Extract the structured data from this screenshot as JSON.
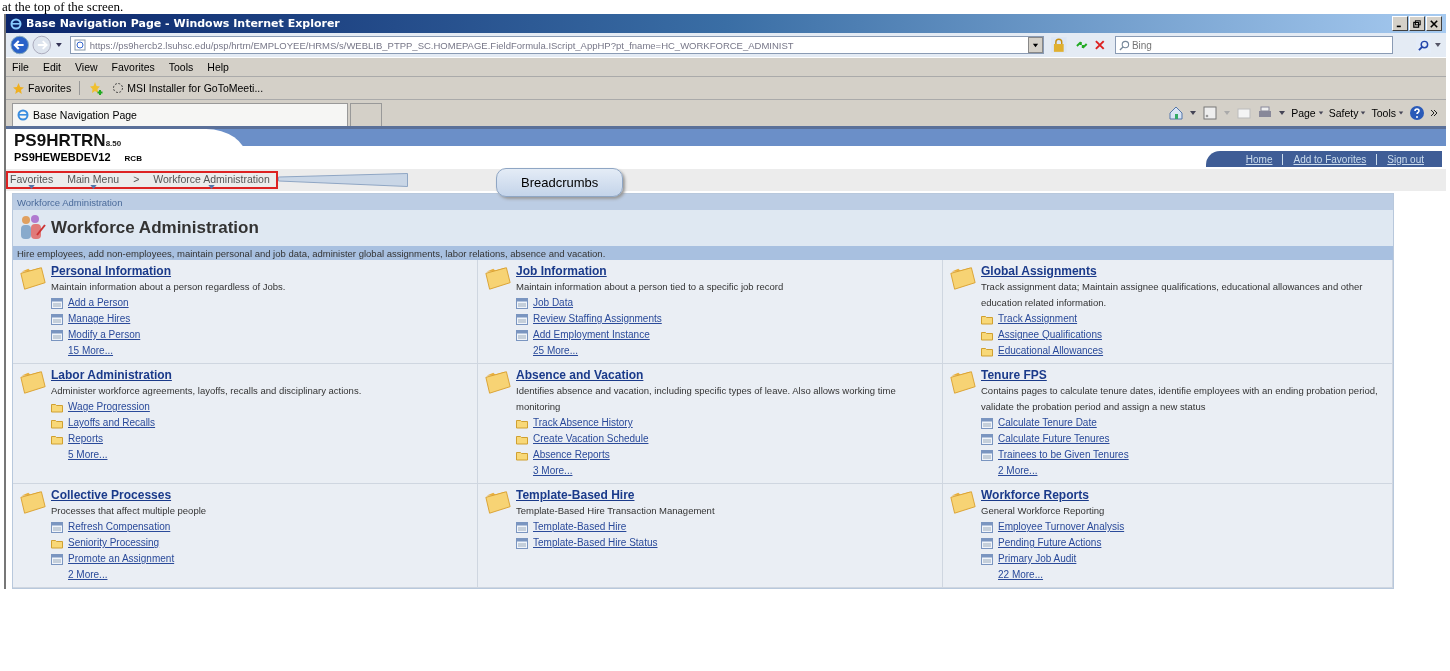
{
  "caption": "at the top of the screen.",
  "window": {
    "title": "Base Navigation Page - Windows Internet Explorer"
  },
  "address": {
    "value": "https://ps9hercb2.lsuhsc.edu/psp/hrtrn/EMPLOYEE/HRMS/s/WEBLIB_PTPP_SC.HOMEPAGE.FieldFormula.IScript_AppHP?pt_fname=HC_WORKFORCE_ADMINIST",
    "search_placeholder": "Bing"
  },
  "menu": [
    "File",
    "Edit",
    "View",
    "Favorites",
    "Tools",
    "Help"
  ],
  "favorites_bar": {
    "label": "Favorites",
    "items": [
      "MSI Installer for GoToMeeti..."
    ]
  },
  "tab": {
    "label": "Base Navigation Page"
  },
  "command_bar": [
    "Page",
    "Safety",
    "Tools"
  ],
  "app": {
    "name": "PS9HRTRN",
    "version": "8.50",
    "server": "PS9HEWEBDEV12",
    "user": "RCB",
    "links": [
      "Home",
      "Add to Favorites",
      "Sign out"
    ]
  },
  "breadcrumbs": [
    {
      "label": "Favorites",
      "dropdown": true
    },
    {
      "label": "Main Menu",
      "dropdown": true
    },
    {
      "label": ">",
      "dropdown": false
    },
    {
      "label": "Workforce Administration",
      "dropdown": true
    }
  ],
  "callout": "Breadcrumbs",
  "page": {
    "path": "Workforce Administration",
    "title": "Workforce Administration",
    "description": "Hire employees, add non-employees, maintain personal and job data, administer global assignments, labor relations, absence and vacation."
  },
  "sections": [
    {
      "title": "Personal Information",
      "description": "Maintain information about a person regardless of Jobs.",
      "links": [
        {
          "kind": "page",
          "label": "Add a Person"
        },
        {
          "kind": "page",
          "label": "Manage Hires"
        },
        {
          "kind": "page",
          "label": "Modify a Person"
        }
      ],
      "more": "15 More..."
    },
    {
      "title": "Job Information",
      "description": "Maintain information about a person tied to a specific job record",
      "links": [
        {
          "kind": "page",
          "label": "Job Data"
        },
        {
          "kind": "page",
          "label": "Review Staffing Assignments"
        },
        {
          "kind": "page",
          "label": "Add Employment Instance"
        }
      ],
      "more": "25 More..."
    },
    {
      "title": "Global Assignments",
      "description": "Track assignment data; Maintain assignee qualifications, educational allowances and other education related information.",
      "links": [
        {
          "kind": "folder",
          "label": "Track Assignment"
        },
        {
          "kind": "folder",
          "label": "Assignee Qualifications"
        },
        {
          "kind": "folder",
          "label": "Educational Allowances"
        }
      ]
    },
    {
      "title": "Labor Administration",
      "description": "Administer workforce agreements, layoffs, recalls and disciplinary actions.",
      "links": [
        {
          "kind": "folder",
          "label": "Wage Progression"
        },
        {
          "kind": "folder",
          "label": "Layoffs and Recalls"
        },
        {
          "kind": "folder",
          "label": "Reports"
        }
      ],
      "more": "5 More..."
    },
    {
      "title": "Absence and Vacation",
      "description": "Identifies absence and vacation, including specific types of leave. Also allows working time monitoring",
      "links": [
        {
          "kind": "folder",
          "label": "Track Absence History"
        },
        {
          "kind": "folder",
          "label": "Create Vacation Schedule"
        },
        {
          "kind": "folder",
          "label": "Absence Reports"
        }
      ],
      "more": "3 More..."
    },
    {
      "title": "Tenure FPS",
      "description": "Contains pages to calculate tenure dates, identifie employees with an ending probation period, validate the probation period and assign a new status",
      "links": [
        {
          "kind": "page",
          "label": "Calculate Tenure Date"
        },
        {
          "kind": "page",
          "label": "Calculate Future Tenures"
        },
        {
          "kind": "page",
          "label": "Trainees to be Given Tenures"
        }
      ],
      "more": "2 More..."
    },
    {
      "title": "Collective Processes",
      "description": "Processes that affect multiple people",
      "links": [
        {
          "kind": "page",
          "label": "Refresh Compensation"
        },
        {
          "kind": "folder",
          "label": "Seniority Processing"
        },
        {
          "kind": "page",
          "label": "Promote an Assignment"
        }
      ],
      "more": "2 More..."
    },
    {
      "title": "Template-Based Hire",
      "description": "Template-Based Hire Transaction Management",
      "links": [
        {
          "kind": "page",
          "label": "Template-Based Hire"
        },
        {
          "kind": "page",
          "label": "Template-Based Hire Status"
        }
      ]
    },
    {
      "title": "Workforce Reports",
      "description": "General Workforce Reporting",
      "links": [
        {
          "kind": "page",
          "label": "Employee Turnover Analysis"
        },
        {
          "kind": "page",
          "label": "Pending Future Actions"
        },
        {
          "kind": "page",
          "label": "Primary Job Audit"
        }
      ],
      "more": "22 More..."
    }
  ]
}
